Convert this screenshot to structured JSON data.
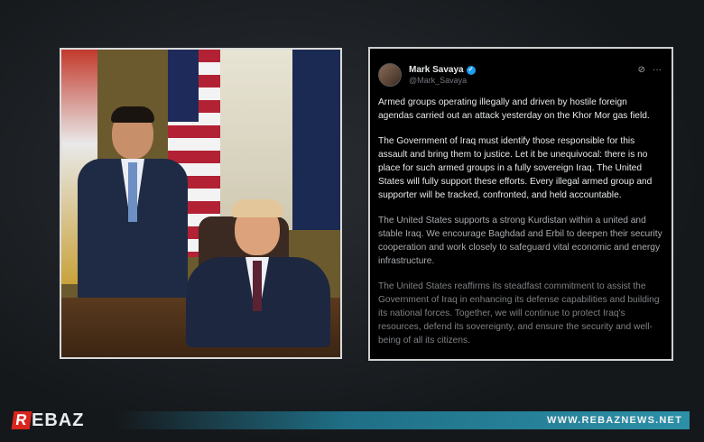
{
  "tweet": {
    "name": "Mark Savaya",
    "handle": "@Mark_Savaya",
    "paragraphs": [
      "Armed groups operating illegally and driven by hostile foreign agendas carried out an attack yesterday on the Khor Mor gas field.",
      "The Government of Iraq must identify those responsible for this assault and bring them to justice. Let it be unequivocal: there is no place for such armed groups in a fully sovereign Iraq. The United States will fully support these efforts. Every illegal armed group and supporter will be tracked, confronted, and held accountable.",
      "The United States supports a strong Kurdistan within a united and stable Iraq. We encourage Baghdad and Erbil to deepen their security cooperation and work closely to safeguard vital economic and energy infrastructure.",
      "The United States reaffirms its steadfast commitment to assist the Government of Iraq in enhancing its defense capabilities and building its national forces. Together, we will continue to protect Iraq's resources, defend its sovereignty, and ensure the security and well-being of all its citizens."
    ],
    "icons": [
      "grok-icon",
      "more-icon"
    ]
  },
  "footer": {
    "logo_mark": "R",
    "logo_text": "EBAZ",
    "site": "WWW.REBAZNEWS.NET"
  },
  "colors": {
    "accent_red": "#d9251d",
    "bar_teal": "#2c90a8",
    "verified_blue": "#1d9bf0"
  }
}
